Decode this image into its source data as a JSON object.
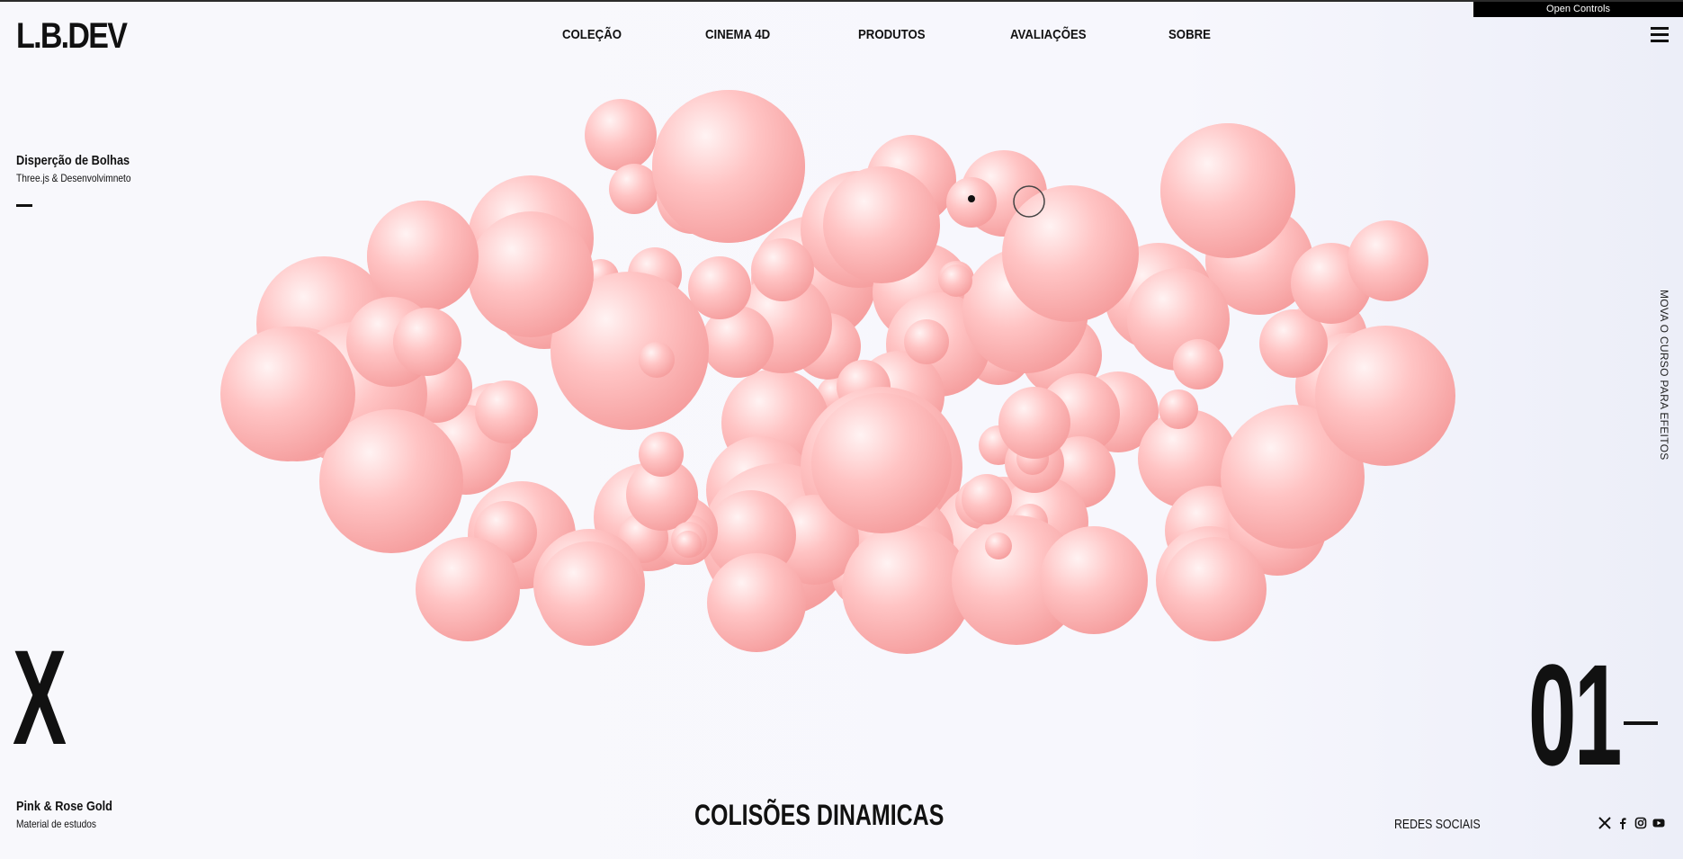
{
  "brand": {
    "logo": "L.B.DEV"
  },
  "nav": {
    "items": [
      "COLEÇÃO",
      "CINEMA 4D",
      "PRODUTOS",
      "AVALIAÇÕES",
      "SOBRE"
    ]
  },
  "controls": {
    "open_label": "Open Controls"
  },
  "project": {
    "title": "Disperção de Bolhas",
    "subtitle": "Three.js & Desenvolvimneto"
  },
  "hint": {
    "text": "MOVA O CURSO PARA EFEITOS"
  },
  "hero": {
    "big_letter": "X",
    "index": "01"
  },
  "material": {
    "title": "Pink & Rose Gold",
    "subtitle": "Material de estudos"
  },
  "headline": "COLISÕES DINAMICAS",
  "social": {
    "label": "REDES SOCIAIS",
    "icons": [
      "x-icon",
      "facebook-icon",
      "instagram-icon",
      "youtube-icon"
    ]
  },
  "colors": {
    "bubble": "#ffb3b3",
    "bubble_light": "#fff1f1",
    "bubble_dark": "#f59b9b",
    "text": "#111111"
  }
}
